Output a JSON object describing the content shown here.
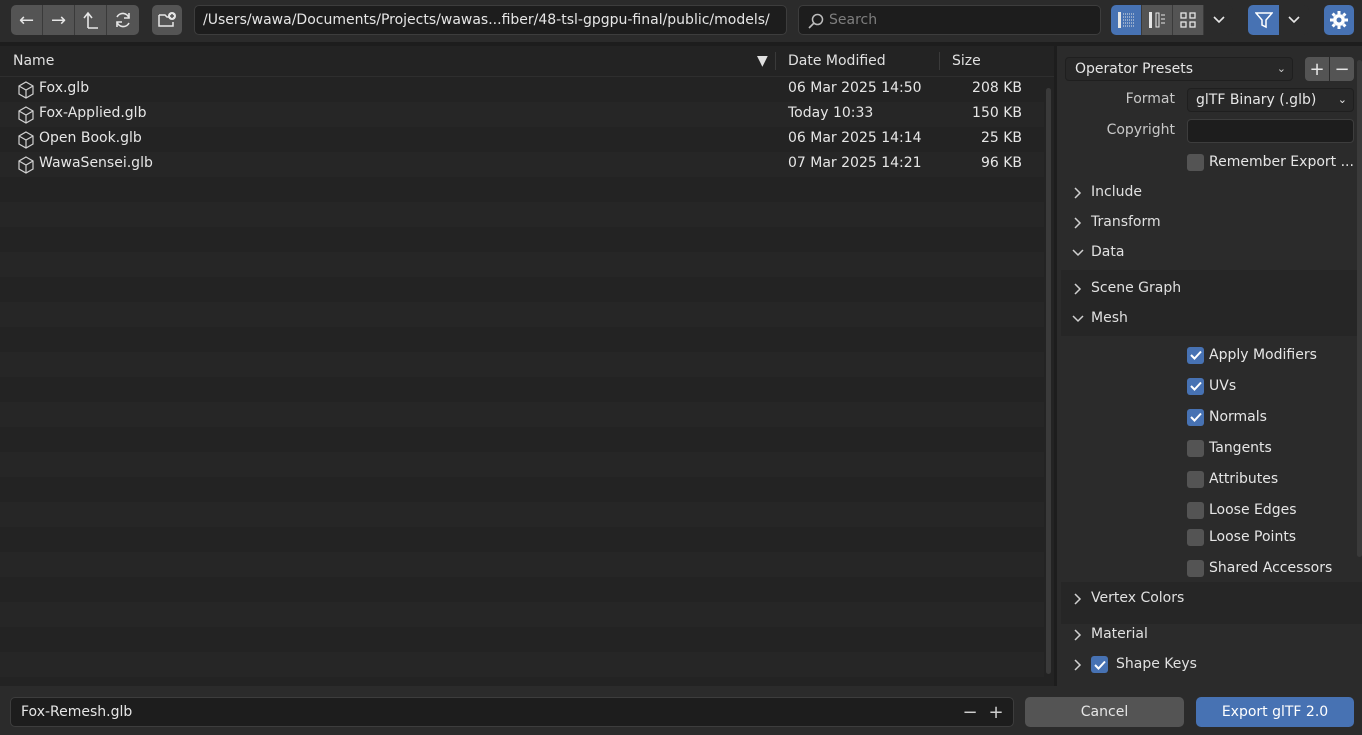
{
  "toolbar": {
    "path": "/Users/wawa/Documents/Projects/wawas...fiber/48-tsl-gpgpu-final/public/models/",
    "search_placeholder": "Search"
  },
  "columns": {
    "name": "Name",
    "date": "Date Modified",
    "size": "Size"
  },
  "files": [
    {
      "name": "Fox.glb",
      "date": "06 Mar 2025 14:50",
      "size": "208 KB"
    },
    {
      "name": "Fox-Applied.glb",
      "date": "Today 10:33",
      "size": "150 KB"
    },
    {
      "name": "Open Book.glb",
      "date": "06 Mar 2025 14:14",
      "size": "25 KB"
    },
    {
      "name": "WawaSensei.glb",
      "date": "07 Mar 2025 14:21",
      "size": "96 KB"
    }
  ],
  "panel": {
    "operator_presets": "Operator Presets",
    "format_label": "Format",
    "format_value": "glTF Binary (.glb)",
    "copyright_label": "Copyright",
    "remember_export": "Remember Export ...",
    "sections": {
      "include": "Include",
      "transform": "Transform",
      "data": "Data",
      "scene_graph": "Scene Graph",
      "mesh": "Mesh",
      "vertex_colors": "Vertex Colors",
      "material": "Material",
      "shape_keys": "Shape Keys"
    },
    "mesh_options": {
      "apply_modifiers": "Apply Modifiers",
      "uvs": "UVs",
      "normals": "Normals",
      "tangents": "Tangents",
      "attributes": "Attributes",
      "loose_edges": "Loose Edges",
      "loose_points": "Loose Points",
      "shared_accessors": "Shared Accessors"
    }
  },
  "bottom": {
    "filename": "Fox-Remesh.glb",
    "cancel": "Cancel",
    "export": "Export glTF 2.0"
  },
  "colors": {
    "accent": "#4772b3",
    "button": "#545454",
    "panel": "#2b2b2b"
  }
}
